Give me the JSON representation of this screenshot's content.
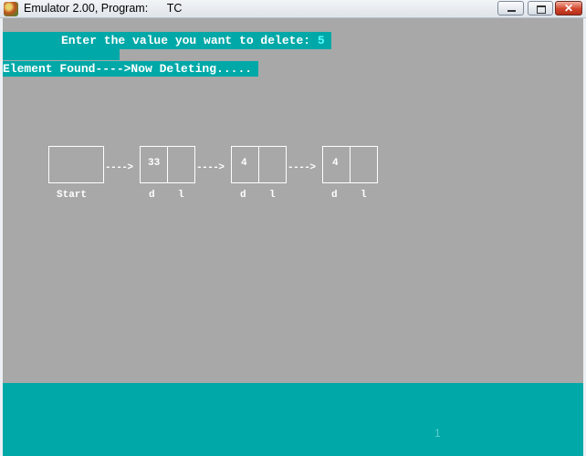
{
  "window": {
    "title": "Emulator 2.00, Program:      TC",
    "controls": {
      "close_glyph": "✕"
    }
  },
  "console": {
    "prompt": "Enter the value you want to delete: ",
    "input_value": "5",
    "status": "Element Found---->Now Deleting....."
  },
  "linked_list": {
    "arrow": "---->",
    "start_label": "Start",
    "nodes": [
      {
        "data": "33",
        "label_data": "d",
        "label_link": "l"
      },
      {
        "data": "4",
        "label_data": "d",
        "label_link": "l"
      },
      {
        "data": "4",
        "label_data": "d",
        "label_link": "l"
      }
    ]
  },
  "status_bar": {
    "page": "1"
  },
  "colors": {
    "console_bg": "#a8a8a8",
    "highlight": "#00a8a8",
    "input": "#55ffff"
  }
}
